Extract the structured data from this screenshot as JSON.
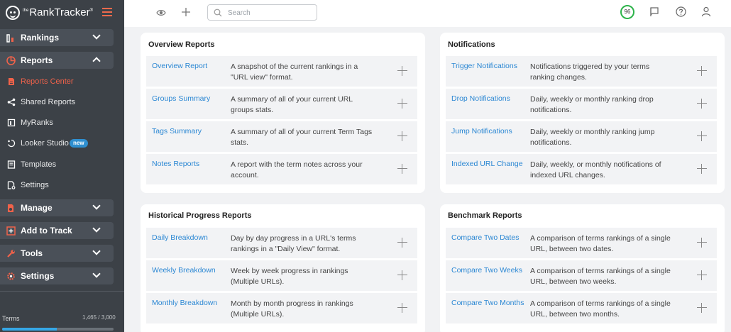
{
  "app": {
    "logo_prefix": "the",
    "logo_name": "RankTracker",
    "logo_tm": "®"
  },
  "sidebar": {
    "groups": [
      {
        "label": "Rankings",
        "icon": "bar-chart-icon"
      },
      {
        "label": "Reports",
        "icon": "pie-chart-icon"
      },
      {
        "label": "Manage",
        "icon": "file-gear-icon"
      },
      {
        "label": "Add to Track",
        "icon": "plus-square-icon"
      },
      {
        "label": "Tools",
        "icon": "wrench-icon"
      },
      {
        "label": "Settings",
        "icon": "gear-icon"
      }
    ],
    "reports_items": [
      {
        "label": "Reports Center",
        "icon": "file-report-icon",
        "active": true
      },
      {
        "label": "Shared Reports",
        "icon": "share-icon"
      },
      {
        "label": "MyRanks",
        "icon": "myranks-icon"
      },
      {
        "label": "Looker Studio",
        "icon": "looker-icon",
        "badge": "new"
      },
      {
        "label": "Templates",
        "icon": "template-icon"
      },
      {
        "label": "Settings",
        "icon": "file-settings-icon"
      }
    ],
    "terms": {
      "label": "Terms",
      "count": "1,465 / 3,000",
      "used": 1465,
      "limit": 3000
    }
  },
  "topbar": {
    "search_placeholder": "Search",
    "score": "96",
    "score_color": "#2db34a"
  },
  "sections": {
    "overview": {
      "title": "Overview Reports",
      "items": [
        {
          "name": "Overview Report",
          "desc": "A snapshot of the current rankings in a \"URL view\" format."
        },
        {
          "name": "Groups Summary",
          "desc": "A summary of all of your current URL groups stats."
        },
        {
          "name": "Tags Summary",
          "desc": "A summary of all of your current Term Tags stats."
        },
        {
          "name": "Notes Reports",
          "desc": "A report with the term notes across your account."
        }
      ]
    },
    "notifications": {
      "title": "Notifications",
      "items": [
        {
          "name": "Trigger Notifications",
          "desc": "Notifications triggered by your terms ranking changes."
        },
        {
          "name": "Drop Notifications",
          "desc": "Daily, weekly or monthly ranking drop notifications."
        },
        {
          "name": "Jump Notifications",
          "desc": "Daily, weekly or monthly ranking jump notifications."
        },
        {
          "name": "Indexed URL Change",
          "desc": "Daily, weekly, or monthly notifications of indexed URL changes."
        }
      ]
    },
    "historical": {
      "title": "Historical Progress Reports",
      "items": [
        {
          "name": "Daily Breakdown",
          "desc": "Day by day progress in a URL's terms rankings in a \"Daily View\" format."
        },
        {
          "name": "Weekly Breakdown",
          "desc": "Week by week progress in rankings (Multiple URLs)."
        },
        {
          "name": "Monthly Breakdown",
          "desc": "Month by month progress in rankings (Multiple URLs)."
        }
      ]
    },
    "benchmark": {
      "title": "Benchmark Reports",
      "items": [
        {
          "name": "Compare Two Dates",
          "desc": "A comparison of terms rankings of a single URL, between two dates."
        },
        {
          "name": "Compare Two Weeks",
          "desc": "A comparison of terms rankings of a single URL, between two weeks."
        },
        {
          "name": "Compare Two Months",
          "desc": "A comparison of terms rankings of a single URL, between two months."
        }
      ]
    }
  },
  "colors": {
    "sidebar_bg": "#3c4147",
    "accent": "#f0624a",
    "link": "#2b87d3",
    "badge": "#2f8fd0"
  }
}
